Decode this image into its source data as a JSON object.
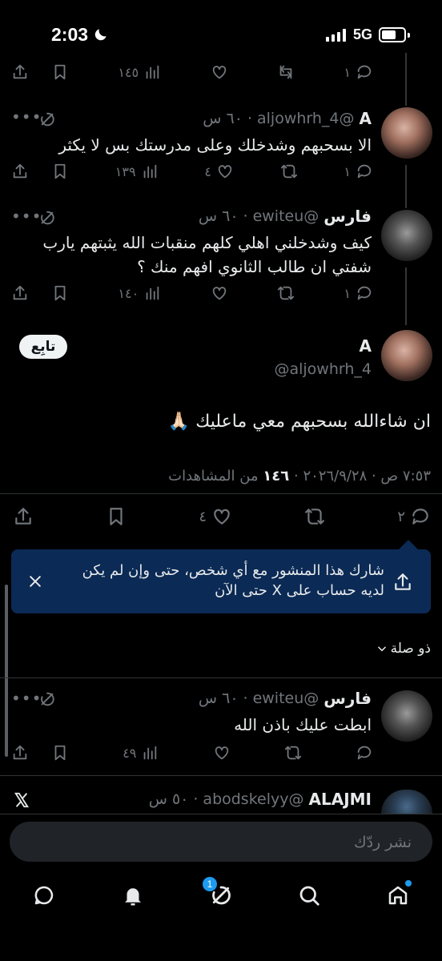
{
  "status_bar": {
    "time": "2:03",
    "network": "5G"
  },
  "top_partial": {
    "views": "١٤٥",
    "replies": "١"
  },
  "tweets": [
    {
      "name": "A",
      "handle": "@aljowhrh_4",
      "time": "٦٠ س",
      "text": "الا بسحبهم وشدخلك وعلى مدرستك بس لا يكثر",
      "replies": "١",
      "retweets": "",
      "likes": "٤",
      "views": "١٣٩"
    },
    {
      "name": "فارس",
      "handle": "@ewiteu",
      "time": "٦٠ س",
      "text": "كيف وشدخلني اهلي كلهم منقبات الله يثبتهم يارب شفتي ان طالب الثانوي افهم منك ؟",
      "replies": "١",
      "retweets": "",
      "likes": "",
      "views": "١٤٠"
    }
  ],
  "main_post": {
    "name": "A",
    "handle": "@aljowhrh_4",
    "follow_label": "تابِع",
    "text": "ان شاءالله بسحبهم معي ماعليك 🙏🏻",
    "date": "٧:٥٣ ص · ٢٠٢٦/٩/٢٨ ·",
    "views_count": "١٤٦",
    "views_label": "من المشاهدات",
    "replies": "٢",
    "likes": "٤"
  },
  "share_toast": {
    "text": "شارك هذا المنشور مع أي شخص، حتى وإن لم يكن لديه حساب على X حتى الآن"
  },
  "sort_label": "ذو صلة",
  "replies": [
    {
      "name": "فارس",
      "handle": "@ewiteu",
      "time": "٦٠ س",
      "text": "ابطت عليك باذن الله",
      "views": "٤٩"
    },
    {
      "name": "ALAJMI",
      "handle": "@abodskelyy",
      "time": "٥٠ س"
    }
  ],
  "composer": {
    "placeholder": "نشر ردّك"
  },
  "tabbar": {
    "grok_badge": "1"
  },
  "colors": {
    "background": "#000000",
    "muted": "#71767b",
    "accent": "#1d9bf0",
    "toast": "#0b2a55"
  }
}
